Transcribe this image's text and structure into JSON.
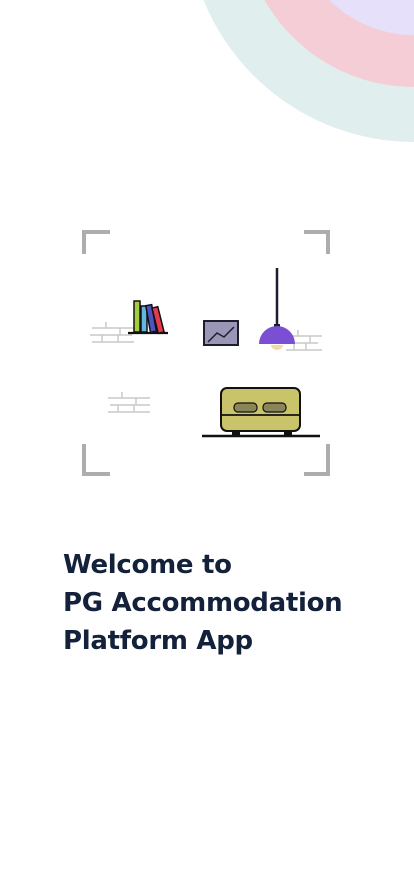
{
  "welcome": {
    "line1": "Welcome to",
    "line2": "PG Accommodation",
    "line3": "Platform App"
  },
  "colors": {
    "title": "#14213a",
    "circle_outer": "#e1eeee",
    "circle_middle": "#f5cdd6",
    "circle_inner": "#e6e0fb",
    "frame": "#adadad",
    "lamp_shade": "#7a4fd3",
    "bed": "#c9c36a",
    "picture_frame": "#9a96b8"
  },
  "icons": {
    "decoration": "concentric-circles",
    "illustration": "room-interior-scan"
  }
}
